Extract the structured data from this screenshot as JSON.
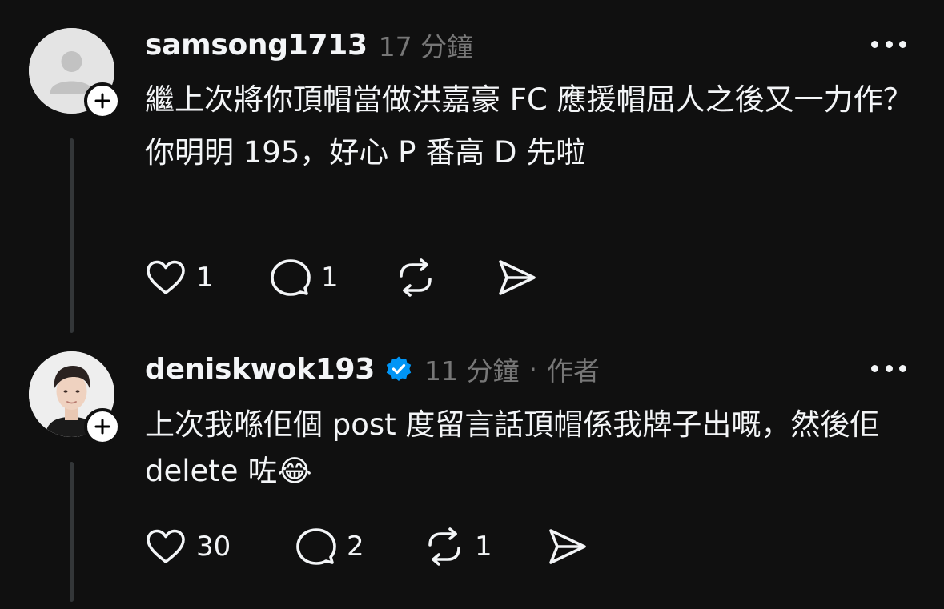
{
  "comments": [
    {
      "username": "samsong1713",
      "time": "17 分鐘",
      "avatar_icon": "default-person-avatar",
      "verified": false,
      "text_lines": [
        "繼上次將你頂帽當做洪嘉豪 FC 應援帽屈人之後又一力作？",
        "你明明 195，好心 P 番高 D 先啦"
      ],
      "likes": "1",
      "replies": "1",
      "reposts": ""
    },
    {
      "username": "deniskwok193",
      "time": "11 分鐘",
      "separator": "·",
      "author_label": "作者",
      "avatar_icon": "profile-photo",
      "verified": true,
      "verified_color": "#0095f6",
      "text_lines": [
        "上次我喺佢個 post 度留言話頂帽係我牌子出嘅，然後佢 delete 咗😂"
      ],
      "likes": "30",
      "replies": "2",
      "reposts": "1"
    }
  ]
}
